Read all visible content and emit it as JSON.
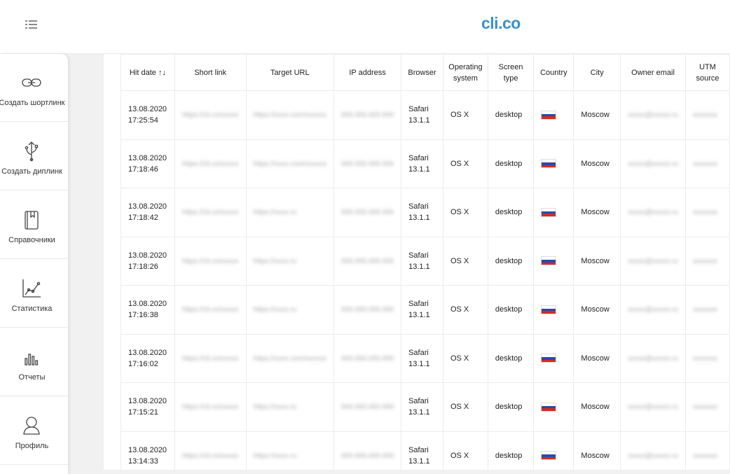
{
  "header": {
    "logo": "cli.co",
    "menu_icon": "list-icon"
  },
  "sidebar": {
    "items": [
      {
        "label": "Создать шортлинк",
        "icon": "link-icon"
      },
      {
        "label": "Создать диплинк",
        "icon": "deeplink-icon"
      },
      {
        "label": "Справочники",
        "icon": "book-icon"
      },
      {
        "label": "Статистика",
        "icon": "chart-line-icon"
      },
      {
        "label": "Отчеты",
        "icon": "bar-chart-icon"
      },
      {
        "label": "Профиль",
        "icon": "user-icon"
      }
    ]
  },
  "table": {
    "columns": [
      "Hit date ↑↓",
      "Short link",
      "Target URL",
      "IP address",
      "Browser",
      "Operating system",
      "Screen type",
      "Country",
      "City",
      "Owner email",
      "UTM source"
    ],
    "rows": [
      {
        "date": "13.08.2020 17:25:54",
        "short": "https://cli.co/xxxxx",
        "target": "https://xxxx.com/xxxxxx",
        "ip": "000.000.000.000",
        "browser": "Safari 13.1.1",
        "os": "OS X",
        "screen": "desktop",
        "country": "RU",
        "city": "Moscow",
        "email": "xxxxx@xxxxx.ru",
        "utm": "xxxxxxx"
      },
      {
        "date": "13.08.2020 17:18:46",
        "short": "https://cli.co/xxxxx",
        "target": "https://xxxx.com/xxxxxx",
        "ip": "000.000.000.000",
        "browser": "Safari 13.1.1",
        "os": "OS X",
        "screen": "desktop",
        "country": "RU",
        "city": "Moscow",
        "email": "xxxxx@xxxxx.ru",
        "utm": "xxxxxxx"
      },
      {
        "date": "13.08.2020 17:18:42",
        "short": "https://cli.co/xxxxx",
        "target": "https://xxxx.ru",
        "ip": "000.000.000.000",
        "browser": "Safari 13.1.1",
        "os": "OS X",
        "screen": "desktop",
        "country": "RU",
        "city": "Moscow",
        "email": "xxxxx@xxxxx.ru",
        "utm": "xxxxxxx"
      },
      {
        "date": "13.08.2020 17:18:26",
        "short": "https://cli.co/xxxxx",
        "target": "https://xxxx.ru",
        "ip": "000.000.000.000",
        "browser": "Safari 13.1.1",
        "os": "OS X",
        "screen": "desktop",
        "country": "RU",
        "city": "Moscow",
        "email": "xxxxx@xxxxx.ru",
        "utm": "xxxxxxx"
      },
      {
        "date": "13.08.2020 17:16:38",
        "short": "https://cli.co/xxxxx",
        "target": "https://xxxx.ru",
        "ip": "000.000.000.000",
        "browser": "Safari 13.1.1",
        "os": "OS X",
        "screen": "desktop",
        "country": "RU",
        "city": "Moscow",
        "email": "xxxxx@xxxxx.ru",
        "utm": "xxxxxxx"
      },
      {
        "date": "13.08.2020 17:16:02",
        "short": "https://cli.co/xxxxx",
        "target": "https://xxxx.com/xxxxxx",
        "ip": "000.000.000.000",
        "browser": "Safari 13.1.1",
        "os": "OS X",
        "screen": "desktop",
        "country": "RU",
        "city": "Moscow",
        "email": "xxxxx@xxxxx.ru",
        "utm": "xxxxxxx"
      },
      {
        "date": "13.08.2020 17:15:21",
        "short": "https://cli.co/xxxxx",
        "target": "https://xxxx.ru",
        "ip": "000.000.000.000",
        "browser": "Safari 13.1.1",
        "os": "OS X",
        "screen": "desktop",
        "country": "RU",
        "city": "Moscow",
        "email": "xxxxx@xxxxx.ru",
        "utm": "xxxxxxx"
      },
      {
        "date": "13.08.2020 13:14:33",
        "short": "https://cli.co/xxxxx",
        "target": "https://xxxx.ru",
        "ip": "000.000.000.000",
        "browser": "Safari 13.1.1",
        "os": "OS X",
        "screen": "desktop",
        "country": "RU",
        "city": "Moscow",
        "email": "xxxxx@xxxxx.ru",
        "utm": "xxxxxxx"
      }
    ]
  }
}
